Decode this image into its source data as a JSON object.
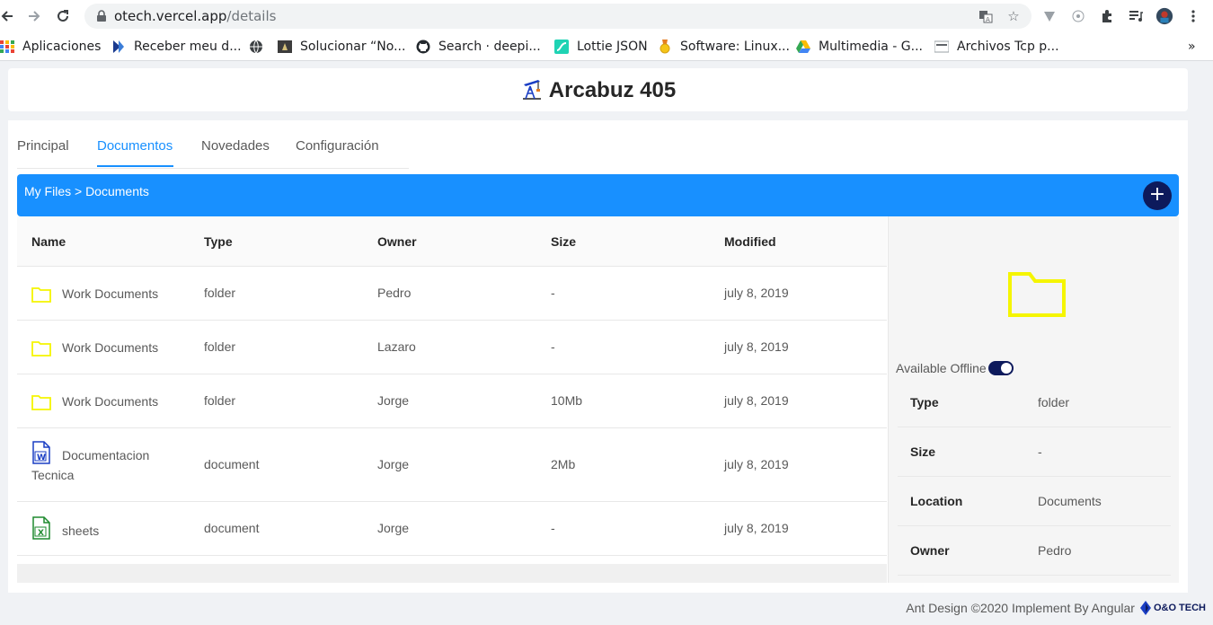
{
  "browser": {
    "url_host": "otech.vercel.app",
    "url_path": "/details",
    "bookmarks": [
      {
        "label": "Aplicaciones",
        "icon": "apps-grid-icon"
      },
      {
        "label": "Receber meu d...",
        "icon": "bookmark-k-icon"
      },
      {
        "label": "",
        "icon": "globe-icon"
      },
      {
        "label": "Solucionar “No...",
        "icon": "terminal-icon"
      },
      {
        "label": "Search · deepi...",
        "icon": "github-icon"
      },
      {
        "label": "Lottie JSON",
        "icon": "lottie-icon"
      },
      {
        "label": "Software: Linux...",
        "icon": "medal-icon"
      },
      {
        "label": "Multimedia - G...",
        "icon": "google-drive-icon"
      },
      {
        "label": "Archivos Tcp p...",
        "icon": "page-icon"
      }
    ],
    "more_bookmarks": "»"
  },
  "app": {
    "title": "Arcabuz 405"
  },
  "tabs": [
    {
      "label": "Principal",
      "active": false
    },
    {
      "label": "Documentos",
      "active": true
    },
    {
      "label": "Novedades",
      "active": false
    },
    {
      "label": "Configuración",
      "active": false
    }
  ],
  "breadcrumb": "My Files > Documents",
  "add_button": "+",
  "table": {
    "columns": [
      "Name",
      "Type",
      "Owner",
      "Size",
      "Modified"
    ],
    "rows": [
      {
        "name": "Work Documents",
        "icon": "folder-icon",
        "type": "folder",
        "owner": "Pedro",
        "size": "-",
        "modified": "july 8, 2019"
      },
      {
        "name": "Work Documents",
        "icon": "folder-icon",
        "type": "folder",
        "owner": "Lazaro",
        "size": "-",
        "modified": "july 8, 2019"
      },
      {
        "name": "Work Documents",
        "icon": "folder-icon",
        "type": "folder",
        "owner": "Jorge",
        "size": "10Mb",
        "modified": "july 8, 2019"
      },
      {
        "name": "Documentacion",
        "name2": "Tecnica",
        "icon": "word-file-icon",
        "type": "document",
        "owner": "Jorge",
        "size": "2Mb",
        "modified": "july 8, 2019"
      },
      {
        "name": "sheets",
        "icon": "excel-file-icon",
        "type": "document",
        "owner": "Jorge",
        "size": "-",
        "modified": "july 8, 2019"
      }
    ]
  },
  "details": {
    "offline_label": "Available Offline",
    "offline_enabled": true,
    "properties": [
      {
        "key": "Type",
        "value": "folder"
      },
      {
        "key": "Size",
        "value": "-"
      },
      {
        "key": "Location",
        "value": "Documents"
      },
      {
        "key": "Owner",
        "value": "Pedro"
      }
    ]
  },
  "footer": {
    "text": "Ant Design ©2020 Implement By Angular",
    "brand": "O&O TECH"
  },
  "colors": {
    "primary": "#1890ff",
    "dark_navy": "#0d1a5c",
    "folder_yellow": "#f5f500",
    "word_blue": "#1a3ec4",
    "excel_green": "#1e8a2e"
  }
}
